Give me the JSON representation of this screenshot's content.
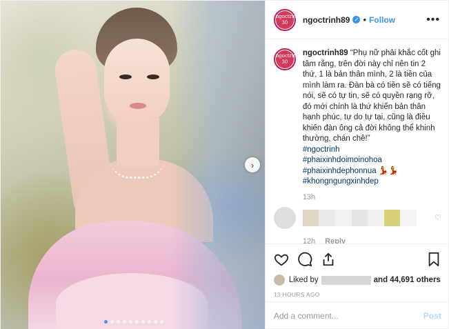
{
  "author": {
    "username": "ngoctrinh89",
    "avatar_text": "ngoctrinh 30",
    "follow_label": "Follow",
    "separator": "•",
    "more_label": "•••"
  },
  "photo": {
    "next_label": "›",
    "slide_count": 10,
    "active_slide": 1
  },
  "caption": {
    "username": "ngoctrinh89",
    "text": "“Phụ nữ phải khắc cốt ghi tâm rằng, trên đời này chỉ nên tin 2 thứ, 1 là bản thân mình, 2 là tiền của mình làm ra. Đàn bà có tiền sẽ có tiếng nói, sẽ có tự tin, sẽ có quyền rạng rỡ, đó mới chính là thứ khiến bản thân hạnh phúc, tự do tự tại, cũng là điều khiến đàn ông cả đời không thể khinh thường, chán chê!”",
    "hashtags": [
      "#ngoctrinh",
      "#phaixinhdoimoinohoa",
      "#phaixinhdephonnua 💃💃",
      "#khongngungxinhdep"
    ],
    "time": "13h"
  },
  "reply": {
    "time": "12h",
    "reply_label": "Reply"
  },
  "likes": {
    "prefix": "Liked by",
    "suffix": "and 44,691 others"
  },
  "timestamp": "13 HOURS AGO",
  "comment_box": {
    "placeholder": "Add a comment...",
    "post_label": "Post"
  },
  "colors": {
    "accent": "#3897f0",
    "post_disabled": "#b3dbff",
    "hashtag": "#003569"
  }
}
